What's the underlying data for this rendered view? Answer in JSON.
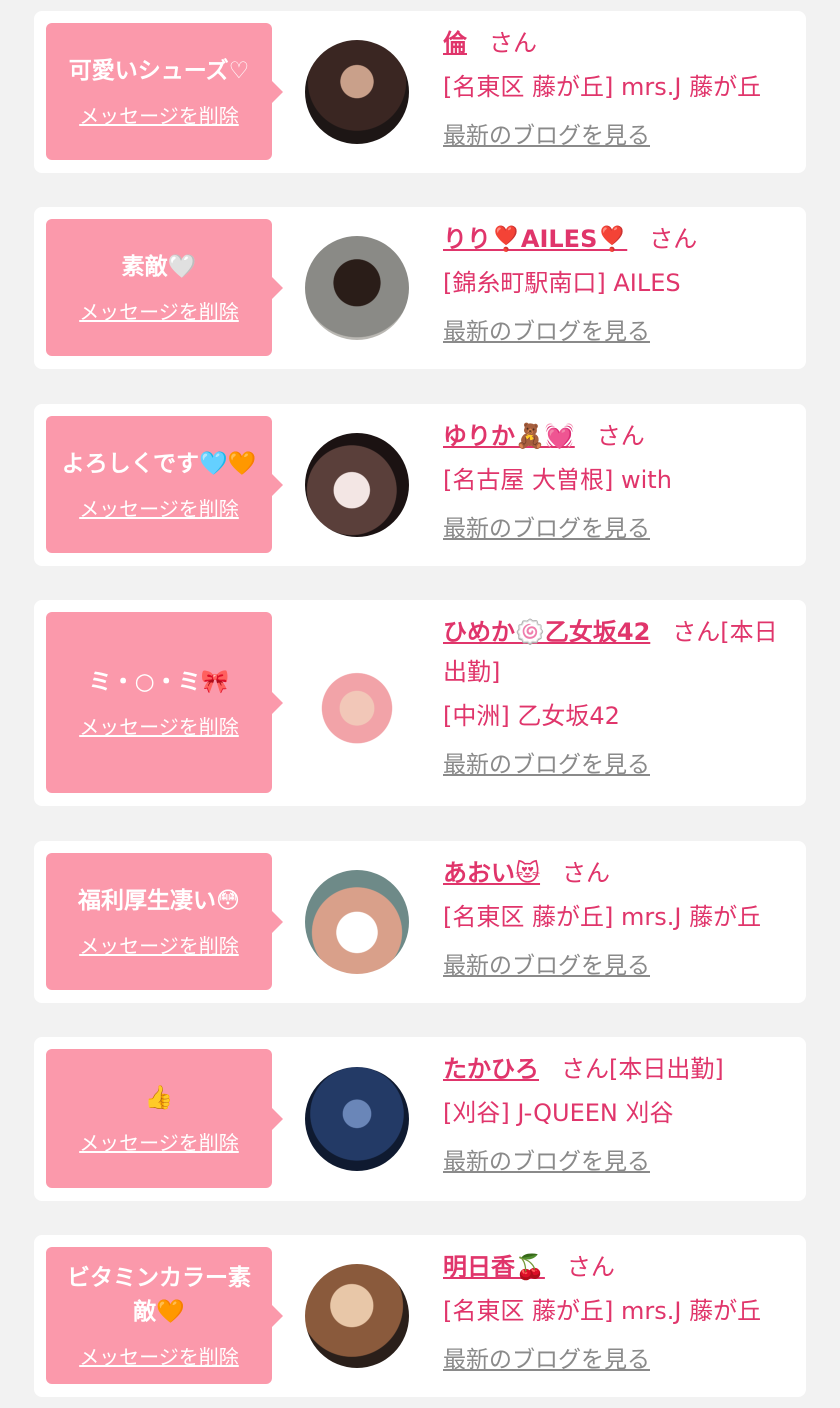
{
  "delete_label": "メッセージを削除",
  "blog_label": "最新のブログを見る",
  "san_label": "さん",
  "colors": {
    "bubble": "#fb99ab",
    "accent": "#e0356b",
    "link_gray": "#8a8a8a"
  },
  "items": [
    {
      "message": "可愛いシューズ♡",
      "name": "倫",
      "suffix": "",
      "shop": "[名東区 藤が丘] mrs.J 藤が丘"
    },
    {
      "message": "素敵🤍",
      "name": "りり❣️AILES❣️",
      "suffix": "",
      "shop": "[錦糸町駅南口] AILES"
    },
    {
      "message": "よろしくです🩵🧡",
      "name": "ゆりか🧸💓",
      "suffix": "",
      "shop": "[名古屋 大曽根] with"
    },
    {
      "message": "ミ・○・ミ🎀",
      "name": "ひめか🍥乙女坂42",
      "suffix": "[本日出勤]",
      "shop": "[中洲] 乙女坂42"
    },
    {
      "message": "福利厚生凄い😳",
      "name": "あおい😻",
      "suffix": "",
      "shop": "[名東区 藤が丘] mrs.J 藤が丘"
    },
    {
      "message": "👍",
      "name": "たかひろ",
      "suffix": "[本日出勤]",
      "shop": "[刈谷] J-QUEEN 刈谷"
    },
    {
      "message": "ビタミンカラー素敵🧡",
      "name": "明日香🍒",
      "suffix": "",
      "shop": "[名東区 藤が丘] mrs.J 藤が丘"
    }
  ]
}
